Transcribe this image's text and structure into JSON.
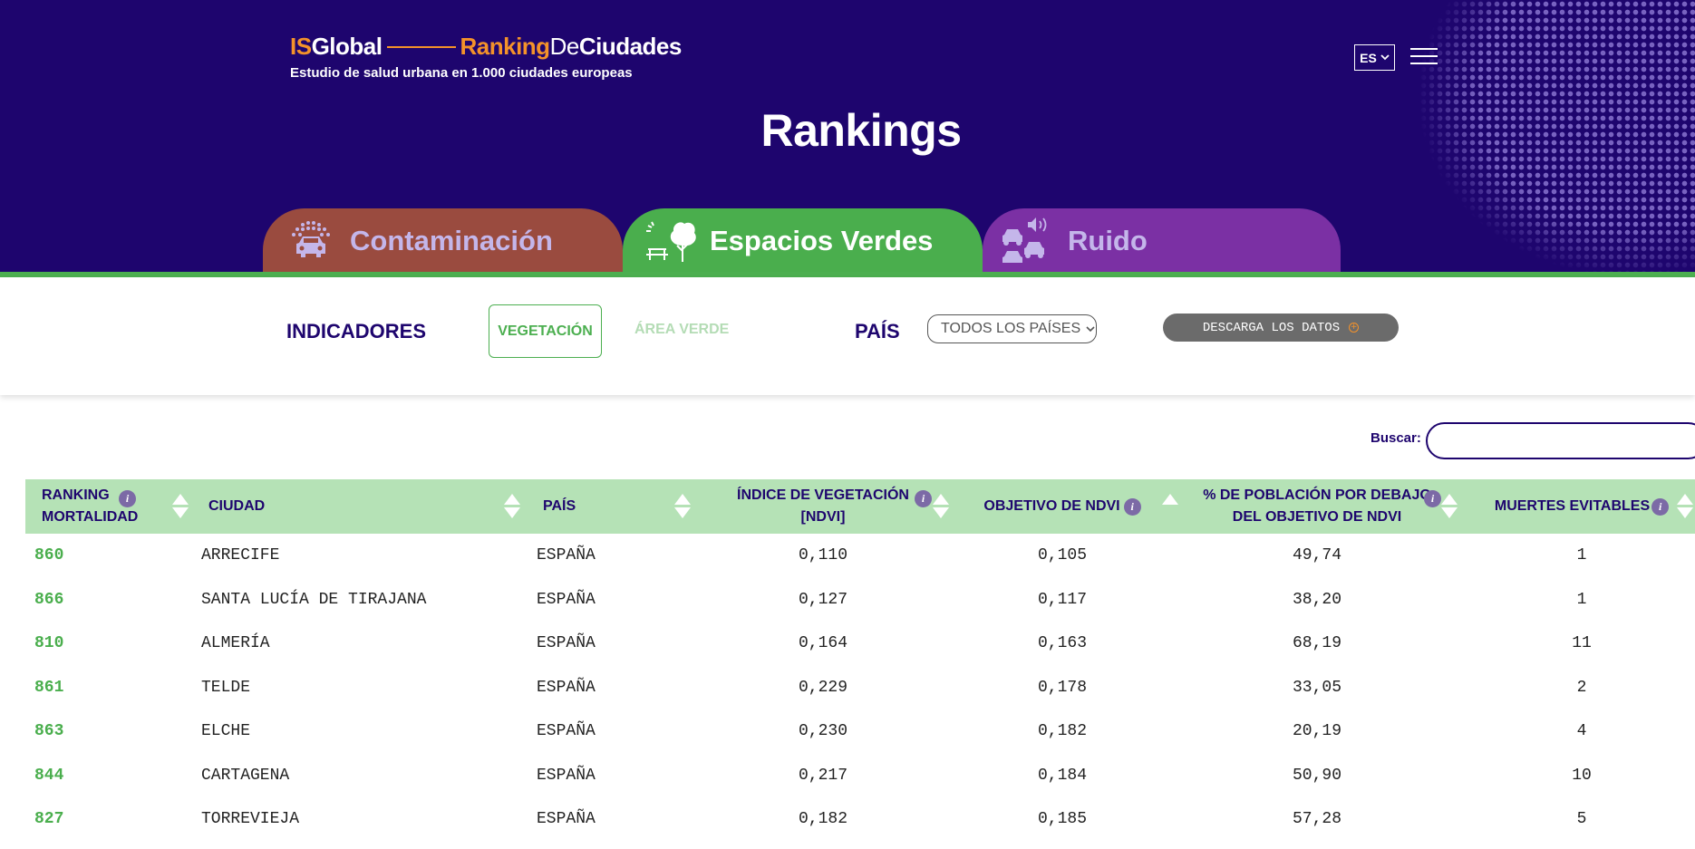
{
  "brand": {
    "logo_is": "IS",
    "logo_global": "Global",
    "logo_ranking": "Ranking",
    "logo_de": "De",
    "logo_ciudades": "Ciudades",
    "subtitle": "Estudio de salud urbana en 1.000 ciudades europeas"
  },
  "header": {
    "language": "ES",
    "title": "Rankings"
  },
  "tabs": [
    {
      "label": "Contaminación",
      "color": "#9a4b3f",
      "icon": "car-smog-icon"
    },
    {
      "label": "Espacios Verdes",
      "color": "#4aae4d",
      "icon": "tree-bench-icon",
      "active": true
    },
    {
      "label": "Ruido",
      "color": "#7b30a4",
      "icon": "traffic-noise-icon"
    }
  ],
  "filters": {
    "indicators_label": "INDICADORES",
    "indicator_options": [
      "VEGETACIÓN",
      "ÁREA VERDE"
    ],
    "selected_indicator": "VEGETACIÓN",
    "country_label": "PAÍS",
    "country_selected": "TODOS LOS PAÍSES",
    "download_label": "DESCARGA LOS DATOS"
  },
  "search": {
    "label": "Buscar:",
    "value": ""
  },
  "table": {
    "columns": [
      {
        "label": "RANKING MORTALIDAD",
        "sort": "both",
        "info": true
      },
      {
        "label": "CIUDAD",
        "sort": "both",
        "info": false
      },
      {
        "label": "PAÍS",
        "sort": "both",
        "info": false
      },
      {
        "label": "ÍNDICE DE VEGETACIÓN [NDVI]",
        "sort": "both",
        "info": true
      },
      {
        "label": "OBJETIVO DE NDVI",
        "sort": "asc",
        "info": true
      },
      {
        "label": "% DE POBLACIÓN POR DEBAJO DEL OBJETIVO DE NDVI",
        "sort": "both",
        "info": true
      },
      {
        "label": "MUERTES EVITABLES",
        "sort": "both",
        "info": true
      }
    ],
    "rows": [
      [
        "860",
        "ARRECIFE",
        "ESPAÑA",
        "0,110",
        "0,105",
        "49,74",
        "1"
      ],
      [
        "866",
        "SANTA LUCÍA DE TIRAJANA",
        "ESPAÑA",
        "0,127",
        "0,117",
        "38,20",
        "1"
      ],
      [
        "810",
        "ALMERÍA",
        "ESPAÑA",
        "0,164",
        "0,163",
        "68,19",
        "11"
      ],
      [
        "861",
        "TELDE",
        "ESPAÑA",
        "0,229",
        "0,178",
        "33,05",
        "2"
      ],
      [
        "863",
        "ELCHE",
        "ESPAÑA",
        "0,230",
        "0,182",
        "20,19",
        "4"
      ],
      [
        "844",
        "CARTAGENA",
        "ESPAÑA",
        "0,217",
        "0,184",
        "50,90",
        "10"
      ],
      [
        "827",
        "TORREVIEJA",
        "ESPAÑA",
        "0,182",
        "0,185",
        "57,28",
        "5"
      ]
    ]
  },
  "colors": {
    "navy": "#1e056e",
    "green": "#4caf50",
    "header_green_row": "#b5e2b6",
    "orange": "#f4922a"
  }
}
